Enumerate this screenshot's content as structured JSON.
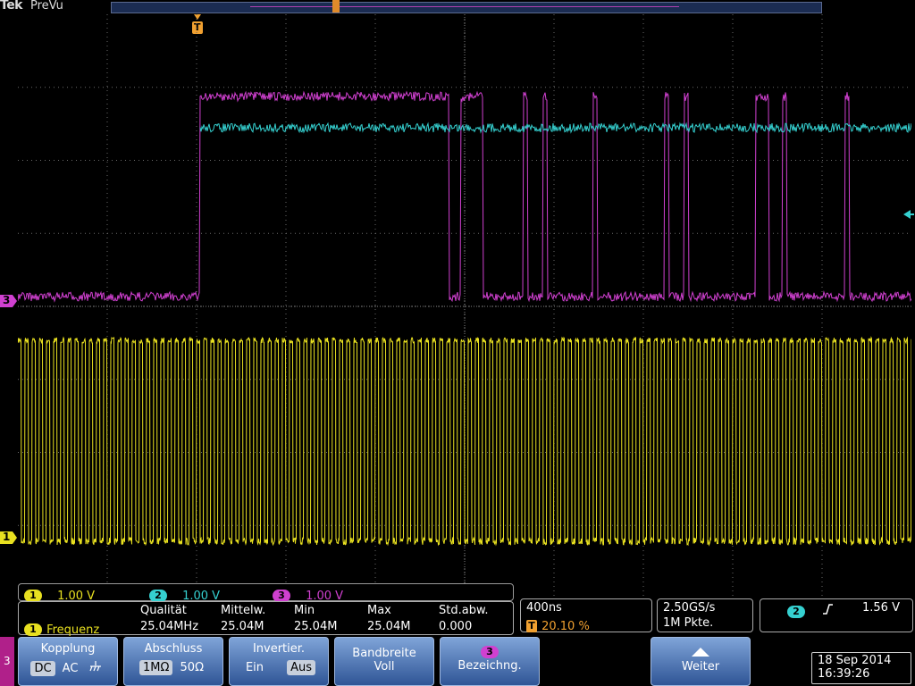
{
  "brand": "Tek",
  "mode": "PreVu",
  "trigger_marker": "T",
  "markers": {
    "ch3": "3",
    "ch1": "1"
  },
  "colors": {
    "ch1": "#e8e020",
    "ch2": "#35d0d0",
    "ch3": "#d040d0",
    "grid": "#6a6a6a"
  },
  "channels": [
    {
      "num": "1",
      "scale": "1.00 V"
    },
    {
      "num": "2",
      "scale": "1.00 V"
    },
    {
      "num": "3",
      "scale": "1.00 V"
    }
  ],
  "measurement": {
    "source": "1",
    "name": "Frequenz",
    "headers": [
      "Qualität",
      "Mittelw.",
      "Min",
      "Max",
      "Std.abw."
    ],
    "values": [
      "25.04MHz",
      "25.04M",
      "25.04M",
      "25.04M",
      "0.000"
    ]
  },
  "timebase": {
    "scale": "400ns",
    "trig_marker": "T",
    "trig_pos": "20.10 %"
  },
  "acquisition": {
    "rate": "2.50GS/s",
    "record": "1M Pkte."
  },
  "trigger": {
    "source": "2",
    "slope_icon": "rising-edge-icon",
    "level": "1.56 V"
  },
  "menu": {
    "channel": "3",
    "kopplung": {
      "label": "Kopplung",
      "options": [
        "DC",
        "AC"
      ],
      "selected": "DC"
    },
    "abschluss": {
      "label": "Abschluss",
      "options": [
        "1MΩ",
        "50Ω"
      ],
      "selected": "1MΩ"
    },
    "invertier": {
      "label": "Invertier.",
      "options": [
        "Ein",
        "Aus"
      ],
      "selected": "Aus"
    },
    "bandbreite": {
      "label": "Bandbreite",
      "value": "Voll"
    },
    "bezeichnung": {
      "badge": "3",
      "label": "Bezeichng."
    },
    "weiter": {
      "label": "Weiter"
    }
  },
  "datetime": {
    "date": "18 Sep  2014",
    "time": "16:39:26"
  }
}
